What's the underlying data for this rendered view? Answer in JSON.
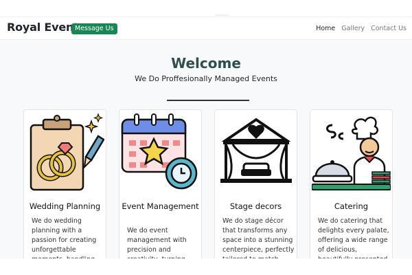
{
  "navbar": {
    "brand": "Royal Events",
    "message_button": "Message Us",
    "links": [
      {
        "label": "Home",
        "active": true
      },
      {
        "label": "Gallery",
        "active": false
      },
      {
        "label": "Contact Us",
        "active": false
      }
    ]
  },
  "hero": {
    "title": "Welcome",
    "subtitle": "We Do Proffesionally Managed Events"
  },
  "cards": [
    {
      "title": "Wedding Planning",
      "text": "We do wedding planning with a passion for creating unforgettable moments, handling",
      "icon": "wedding-planning-icon"
    },
    {
      "title": "Event Management",
      "text": "We do event management with precision and creativity, turning your vision into",
      "icon": "event-calendar-icon"
    },
    {
      "title": "Stage decors",
      "text": "We do stage décor that transforms any space into a stunning centerpiece, perfectly tailored to match your",
      "icon": "stage-decor-icon"
    },
    {
      "title": "Catering",
      "text": "We do catering that delights every palate, offering a wide range of delicious, beautifully presented dishes to",
      "icon": "chef-catering-icon"
    }
  ],
  "colors": {
    "accent_green": "#198754",
    "page_bg": "#f8f9fa",
    "heading": "#2f4f4f"
  }
}
